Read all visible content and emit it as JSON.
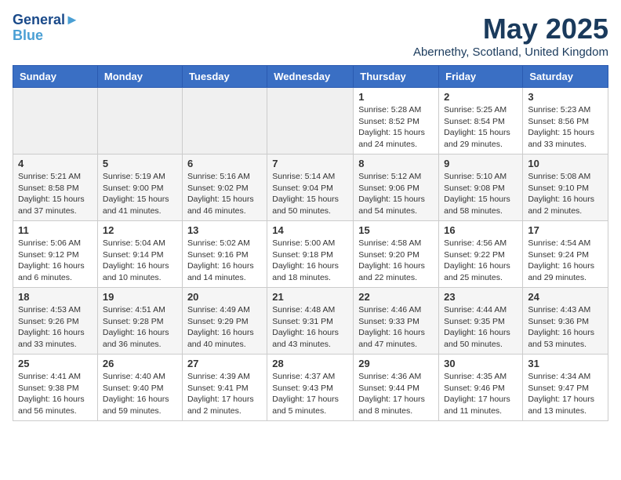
{
  "header": {
    "logo_line1": "General",
    "logo_line2": "Blue",
    "month_title": "May 2025",
    "location": "Abernethy, Scotland, United Kingdom"
  },
  "days_of_week": [
    "Sunday",
    "Monday",
    "Tuesday",
    "Wednesday",
    "Thursday",
    "Friday",
    "Saturday"
  ],
  "weeks": [
    [
      {
        "day": "",
        "info": ""
      },
      {
        "day": "",
        "info": ""
      },
      {
        "day": "",
        "info": ""
      },
      {
        "day": "",
        "info": ""
      },
      {
        "day": "1",
        "info": "Sunrise: 5:28 AM\nSunset: 8:52 PM\nDaylight: 15 hours\nand 24 minutes."
      },
      {
        "day": "2",
        "info": "Sunrise: 5:25 AM\nSunset: 8:54 PM\nDaylight: 15 hours\nand 29 minutes."
      },
      {
        "day": "3",
        "info": "Sunrise: 5:23 AM\nSunset: 8:56 PM\nDaylight: 15 hours\nand 33 minutes."
      }
    ],
    [
      {
        "day": "4",
        "info": "Sunrise: 5:21 AM\nSunset: 8:58 PM\nDaylight: 15 hours\nand 37 minutes."
      },
      {
        "day": "5",
        "info": "Sunrise: 5:19 AM\nSunset: 9:00 PM\nDaylight: 15 hours\nand 41 minutes."
      },
      {
        "day": "6",
        "info": "Sunrise: 5:16 AM\nSunset: 9:02 PM\nDaylight: 15 hours\nand 46 minutes."
      },
      {
        "day": "7",
        "info": "Sunrise: 5:14 AM\nSunset: 9:04 PM\nDaylight: 15 hours\nand 50 minutes."
      },
      {
        "day": "8",
        "info": "Sunrise: 5:12 AM\nSunset: 9:06 PM\nDaylight: 15 hours\nand 54 minutes."
      },
      {
        "day": "9",
        "info": "Sunrise: 5:10 AM\nSunset: 9:08 PM\nDaylight: 15 hours\nand 58 minutes."
      },
      {
        "day": "10",
        "info": "Sunrise: 5:08 AM\nSunset: 9:10 PM\nDaylight: 16 hours\nand 2 minutes."
      }
    ],
    [
      {
        "day": "11",
        "info": "Sunrise: 5:06 AM\nSunset: 9:12 PM\nDaylight: 16 hours\nand 6 minutes."
      },
      {
        "day": "12",
        "info": "Sunrise: 5:04 AM\nSunset: 9:14 PM\nDaylight: 16 hours\nand 10 minutes."
      },
      {
        "day": "13",
        "info": "Sunrise: 5:02 AM\nSunset: 9:16 PM\nDaylight: 16 hours\nand 14 minutes."
      },
      {
        "day": "14",
        "info": "Sunrise: 5:00 AM\nSunset: 9:18 PM\nDaylight: 16 hours\nand 18 minutes."
      },
      {
        "day": "15",
        "info": "Sunrise: 4:58 AM\nSunset: 9:20 PM\nDaylight: 16 hours\nand 22 minutes."
      },
      {
        "day": "16",
        "info": "Sunrise: 4:56 AM\nSunset: 9:22 PM\nDaylight: 16 hours\nand 25 minutes."
      },
      {
        "day": "17",
        "info": "Sunrise: 4:54 AM\nSunset: 9:24 PM\nDaylight: 16 hours\nand 29 minutes."
      }
    ],
    [
      {
        "day": "18",
        "info": "Sunrise: 4:53 AM\nSunset: 9:26 PM\nDaylight: 16 hours\nand 33 minutes."
      },
      {
        "day": "19",
        "info": "Sunrise: 4:51 AM\nSunset: 9:28 PM\nDaylight: 16 hours\nand 36 minutes."
      },
      {
        "day": "20",
        "info": "Sunrise: 4:49 AM\nSunset: 9:29 PM\nDaylight: 16 hours\nand 40 minutes."
      },
      {
        "day": "21",
        "info": "Sunrise: 4:48 AM\nSunset: 9:31 PM\nDaylight: 16 hours\nand 43 minutes."
      },
      {
        "day": "22",
        "info": "Sunrise: 4:46 AM\nSunset: 9:33 PM\nDaylight: 16 hours\nand 47 minutes."
      },
      {
        "day": "23",
        "info": "Sunrise: 4:44 AM\nSunset: 9:35 PM\nDaylight: 16 hours\nand 50 minutes."
      },
      {
        "day": "24",
        "info": "Sunrise: 4:43 AM\nSunset: 9:36 PM\nDaylight: 16 hours\nand 53 minutes."
      }
    ],
    [
      {
        "day": "25",
        "info": "Sunrise: 4:41 AM\nSunset: 9:38 PM\nDaylight: 16 hours\nand 56 minutes."
      },
      {
        "day": "26",
        "info": "Sunrise: 4:40 AM\nSunset: 9:40 PM\nDaylight: 16 hours\nand 59 minutes."
      },
      {
        "day": "27",
        "info": "Sunrise: 4:39 AM\nSunset: 9:41 PM\nDaylight: 17 hours\nand 2 minutes."
      },
      {
        "day": "28",
        "info": "Sunrise: 4:37 AM\nSunset: 9:43 PM\nDaylight: 17 hours\nand 5 minutes."
      },
      {
        "day": "29",
        "info": "Sunrise: 4:36 AM\nSunset: 9:44 PM\nDaylight: 17 hours\nand 8 minutes."
      },
      {
        "day": "30",
        "info": "Sunrise: 4:35 AM\nSunset: 9:46 PM\nDaylight: 17 hours\nand 11 minutes."
      },
      {
        "day": "31",
        "info": "Sunrise: 4:34 AM\nSunset: 9:47 PM\nDaylight: 17 hours\nand 13 minutes."
      }
    ]
  ]
}
